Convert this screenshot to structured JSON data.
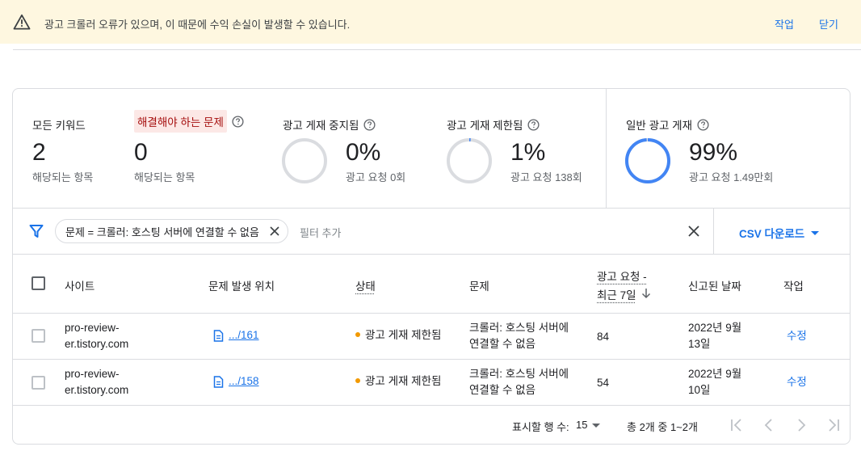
{
  "banner": {
    "message": "광고 크롤러 오류가 있으며, 이 때문에 수익 손실이 발생할 수 있습니다.",
    "action_label": "작업",
    "close_label": "닫기"
  },
  "stats": {
    "all_keywords": {
      "label": "모든 키워드",
      "value": "2",
      "sub": "해당되는 항목"
    },
    "issues": {
      "label": "해결해야 하는 문제",
      "value": "0",
      "sub": "해당되는 항목"
    },
    "paused": {
      "label": "광고 게재 중지됨",
      "value": "0%",
      "sub": "광고 요청 0회",
      "fraction": 0.0
    },
    "limited": {
      "label": "광고 게재 제한됨",
      "value": "1%",
      "sub": "광고 요청 138회",
      "fraction": 0.01
    },
    "normal": {
      "label": "일반 광고 게재",
      "value": "99%",
      "sub": "광고 요청 1.49만회",
      "fraction": 0.99
    }
  },
  "filter": {
    "chip_label": "문제 = 크롤러: 호스팅 서버에 연결할 수 없음",
    "add_placeholder": "필터 추가",
    "csv_label": "CSV 다운로드"
  },
  "table": {
    "headers": {
      "site": "사이트",
      "location": "문제 발생 위치",
      "status": "상태",
      "issue": "문제",
      "requests_line1": "광고 요청 -",
      "requests_line2": "최근 7일",
      "reported": "신고된 날짜",
      "action": "작업"
    },
    "rows": [
      {
        "site_line1": "pro-review-",
        "site_line2": "er.tistory.com",
        "location": ".../161",
        "status": "광고 게재 제한됨",
        "issue_line1": "크롤러: 호스팅 서버에",
        "issue_line2": "연결할 수 없음",
        "requests": "84",
        "date_line1": "2022년 9월",
        "date_line2": "13일",
        "action": "수정"
      },
      {
        "site_line1": "pro-review-",
        "site_line2": "er.tistory.com",
        "location": ".../158",
        "status": "광고 게재 제한됨",
        "issue_line1": "크롤러: 호스팅 서버에",
        "issue_line2": "연결할 수 없음",
        "requests": "54",
        "date_line1": "2022년 9월",
        "date_line2": "10일",
        "action": "수정"
      }
    ]
  },
  "pagination": {
    "rows_label": "표시할 행 수:",
    "rows_value": "15",
    "range": "총 2개 중 1~2개"
  },
  "colors": {
    "accent": "#1a73e8",
    "banner_bg": "#fef7e0",
    "ring_empty": "#dadce0",
    "ring_filled": "#4285f4",
    "status_dot": "#f29900",
    "issue_chip_bg": "#fce8e6"
  }
}
